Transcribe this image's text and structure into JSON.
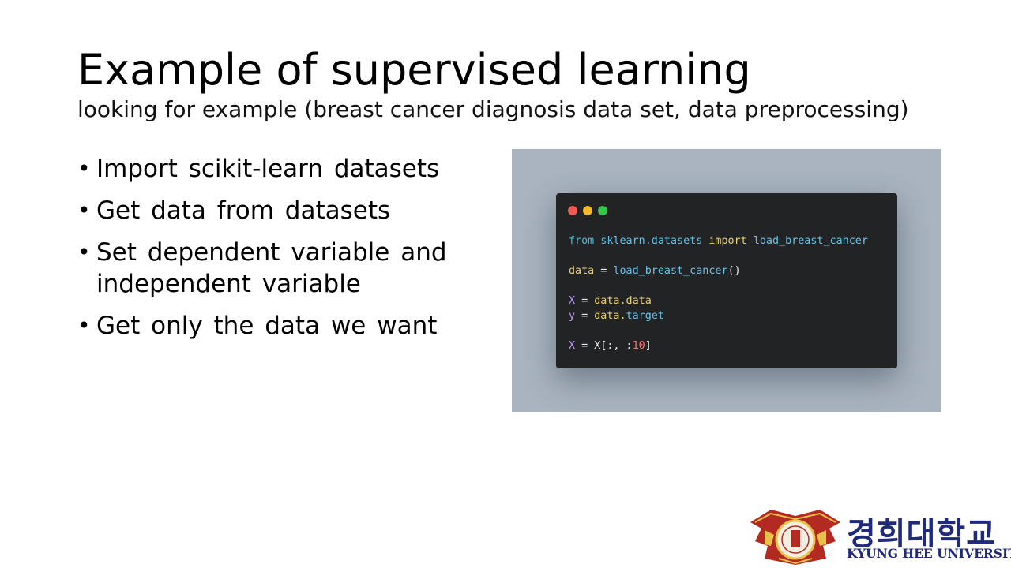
{
  "slide": {
    "title": "Example of supervised learning",
    "subtitle": "looking for example (breast cancer diagnosis data set, data preprocessing)",
    "bullets": [
      "Import scikit-learn datasets",
      "Get data from datasets",
      "Set dependent variable and independent variable",
      "Get only the data we want"
    ]
  },
  "code": {
    "line1": {
      "kw1": "from",
      "module": "sklearn.datasets",
      "kw2": "import",
      "name": "load_breast_cancer"
    },
    "line2": {
      "var": "data",
      "op": " = ",
      "fn": "load_breast_cancer",
      "paren": "()"
    },
    "line3": {
      "var": "X",
      "op": " = ",
      "expr": "data.data"
    },
    "line4": {
      "var": "y",
      "op": " = ",
      "expr_a": "data.",
      "expr_b": "target"
    },
    "line5": {
      "var": "X",
      "op": " = ",
      "expr": "X[:, :",
      "num": "10",
      "close": "]"
    }
  },
  "logo": {
    "korean": "경희대학교",
    "english": "KYUNG HEE UNIVERSITY"
  },
  "colors": {
    "panel_bg": "#a9b4c0",
    "window_bg": "#222325",
    "logo_text": "#1f2a7a",
    "logo_emblem": "#b32a22"
  }
}
